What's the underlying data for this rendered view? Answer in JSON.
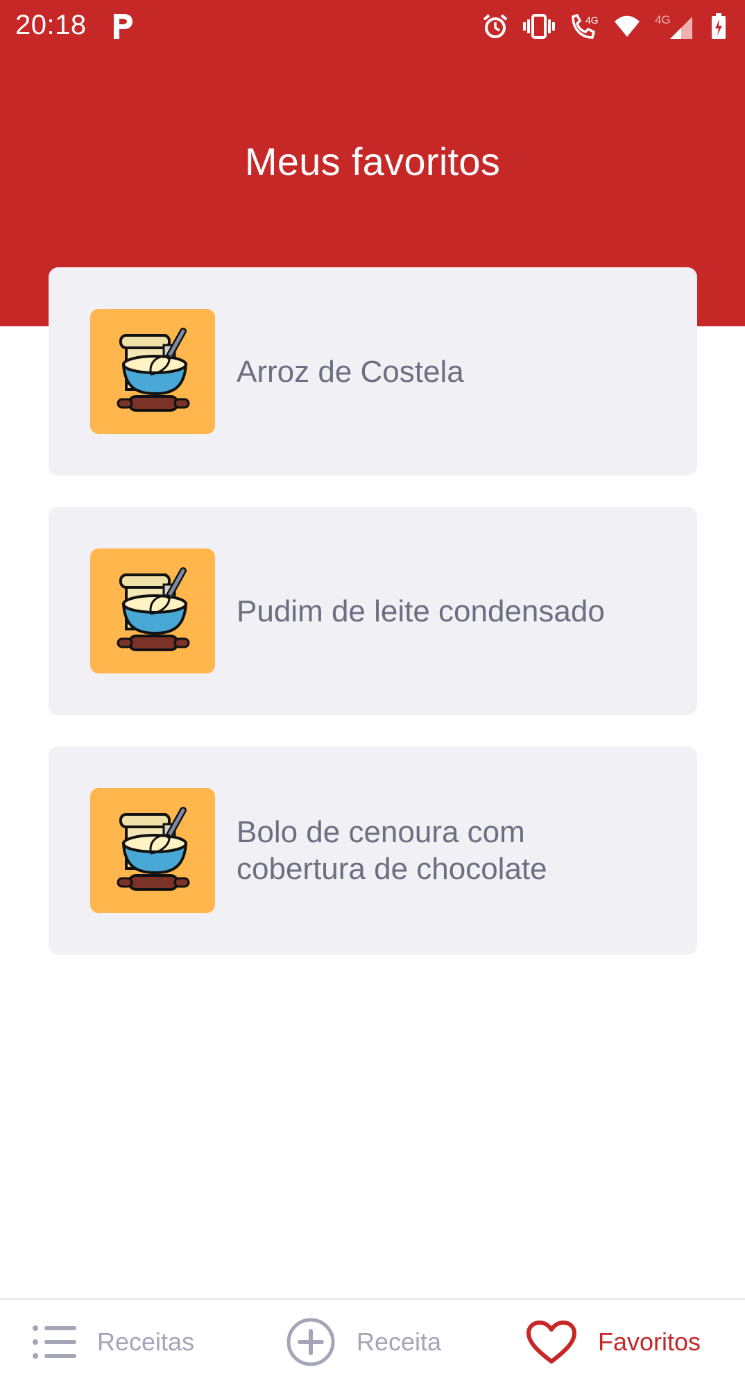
{
  "status_bar": {
    "time": "20:18",
    "network_label_1": "4G",
    "network_label_2": "4G"
  },
  "header": {
    "title": "Meus favoritos",
    "background_color": "#c62828"
  },
  "favorites": [
    {
      "title": "Arroz de Costela",
      "icon": "recipe-baking-icon"
    },
    {
      "title": "Pudim de leite condensado",
      "icon": "recipe-baking-icon"
    },
    {
      "title": "Bolo de cenoura com cobertura de chocolate",
      "icon": "recipe-baking-icon"
    }
  ],
  "bottom_nav": {
    "items": [
      {
        "label": "Receitas",
        "icon": "list-icon",
        "active": false
      },
      {
        "label": "Receita",
        "icon": "plus-circle-icon",
        "active": false
      },
      {
        "label": "Favoritos",
        "icon": "heart-icon",
        "active": true
      }
    ],
    "active_color": "#c62828",
    "inactive_color": "#a5a5b8"
  }
}
